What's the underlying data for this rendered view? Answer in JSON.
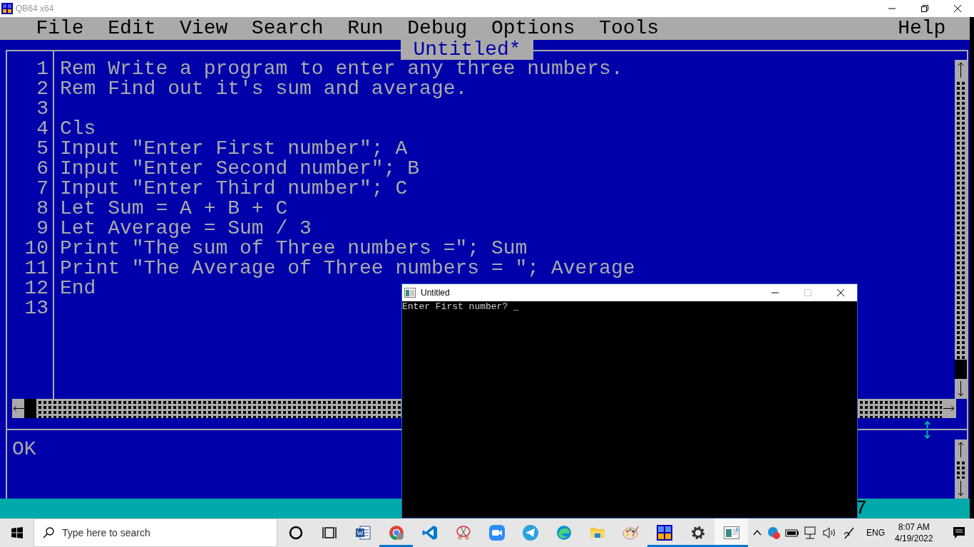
{
  "window": {
    "title": "QB64 x64"
  },
  "menu": [
    {
      "label": "File"
    },
    {
      "label": "Edit"
    },
    {
      "label": "View"
    },
    {
      "label": "Search"
    },
    {
      "label": "Run"
    },
    {
      "label": "Debug"
    },
    {
      "label": "Options"
    },
    {
      "label": "Tools"
    },
    {
      "label": "Help"
    }
  ],
  "editor": {
    "title": "Untitled*",
    "lines": [
      {
        "number": "1",
        "text": "Rem Write a program to enter any three numbers."
      },
      {
        "number": "2",
        "text": "Rem Find out it's sum and average."
      },
      {
        "number": "3"
      },
      {
        "number": "4",
        "text": "Cls"
      },
      {
        "number": "5",
        "text": "Input \"Enter First number\"; A"
      },
      {
        "number": "6",
        "text": "Input \"Enter Second number\"; B"
      },
      {
        "number": "7",
        "text": "Input \"Enter Third number\"; C"
      },
      {
        "number": "8",
        "text": "Let Sum = A + B + C"
      },
      {
        "number": "9",
        "text": "Let Average = Sum / 3"
      },
      {
        "number": "10",
        "text": "Print \"The sum of Three numbers =\"; Sum"
      },
      {
        "number": "11",
        "text": "Print \"The Average of Three numbers = \"; Average"
      },
      {
        "number": "12",
        "text": "End"
      },
      {
        "number": "13"
      }
    ]
  },
  "immediate": {
    "text": "OK"
  },
  "status_bar": {
    "text": "7"
  },
  "console": {
    "title": "Untitled",
    "output": "Enter First number? _"
  },
  "taskbar": {
    "search": {
      "placeholder": "Type here to search"
    },
    "apps": [
      {
        "kind": "cortana",
        "running": false,
        "selected": false
      },
      {
        "kind": "taskview",
        "running": false,
        "selected": false
      },
      {
        "kind": "word",
        "running": false,
        "selected": false
      },
      {
        "kind": "chrome",
        "running": true,
        "selected": false
      },
      {
        "kind": "vscode",
        "running": false,
        "selected": false
      },
      {
        "kind": "snip",
        "running": false,
        "selected": false
      },
      {
        "kind": "zoom",
        "running": false,
        "selected": false
      },
      {
        "kind": "telegram",
        "running": false,
        "selected": false
      },
      {
        "kind": "edge",
        "running": false,
        "selected": false
      },
      {
        "kind": "explorer",
        "running": false,
        "selected": false
      },
      {
        "kind": "paint",
        "running": false,
        "selected": false
      },
      {
        "kind": "qb64",
        "running": true,
        "selected": false
      },
      {
        "kind": "settings",
        "running": true,
        "selected": false
      },
      {
        "kind": "window",
        "running": true,
        "selected": true
      }
    ],
    "tray": {
      "language": "ENG",
      "time": "8:07 AM",
      "date": "4/19/2022"
    }
  }
}
